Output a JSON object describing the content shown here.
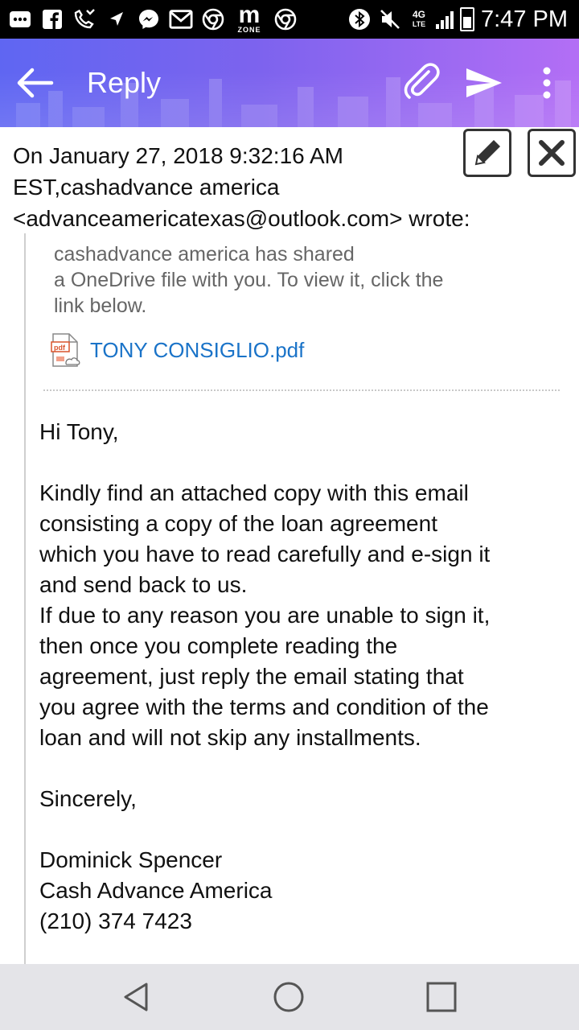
{
  "status_bar": {
    "time": "7:47 PM",
    "network_label": "4G",
    "network_sub": "LTE",
    "zone_label": "ZONE",
    "icons": [
      "more-icon",
      "facebook-icon",
      "missed-call-icon",
      "navigation-icon",
      "messenger-icon",
      "gmail-icon",
      "chrome-icon",
      "mzone-icon",
      "chrome-icon",
      "bluetooth-icon",
      "mute-icon",
      "lte-icon",
      "signal-icon",
      "battery-icon"
    ]
  },
  "app_bar": {
    "title": "Reply",
    "back_icon": "arrow-left-icon",
    "attach_icon": "paperclip-icon",
    "send_icon": "send-icon",
    "more_icon": "overflow-menu-icon",
    "gradient_start": "#5f66f2",
    "gradient_end": "#b36ef5"
  },
  "quote": {
    "header_line1": "On January 27, 2018 9:32:16 AM",
    "header_line2": "EST,cashadvance america",
    "header_line3": "<advanceamericatexas@outlook.com> wrote:",
    "edit_icon": "pencil-icon",
    "close_icon": "close-icon"
  },
  "share": {
    "line1": "cashadvance america has shared",
    "line2": "a OneDrive file with you. To view it, click the",
    "line3": "link below.",
    "attachment_name": "TONY CONSIGLIO.pdf",
    "attachment_icon": "pdf-file-icon",
    "link_color": "#1a73c8"
  },
  "body": {
    "greeting": "Hi Tony,",
    "para1_line1": "Kindly find an attached copy with this email",
    "para1_line2": "consisting a copy of the loan agreement",
    "para1_line3": "which you have to read carefully and e-sign it",
    "para1_line4": "and send back to us.",
    "para2_line1": "If due to any reason you are unable to sign it,",
    "para2_line2": "then once you complete reading the",
    "para2_line3": "agreement, just reply the email stating that",
    "para2_line4": "you agree with the terms and condition of the",
    "para2_line5": "loan and will not skip any installments.",
    "closing": "Sincerely,",
    "sig_name": "Dominick Spencer",
    "sig_company": "Cash Advance America",
    "sig_phone": "(210) 374 7423"
  },
  "nav_bar": {
    "back_icon": "nav-back-icon",
    "home_icon": "nav-home-icon",
    "recents_icon": "nav-recents-icon"
  }
}
